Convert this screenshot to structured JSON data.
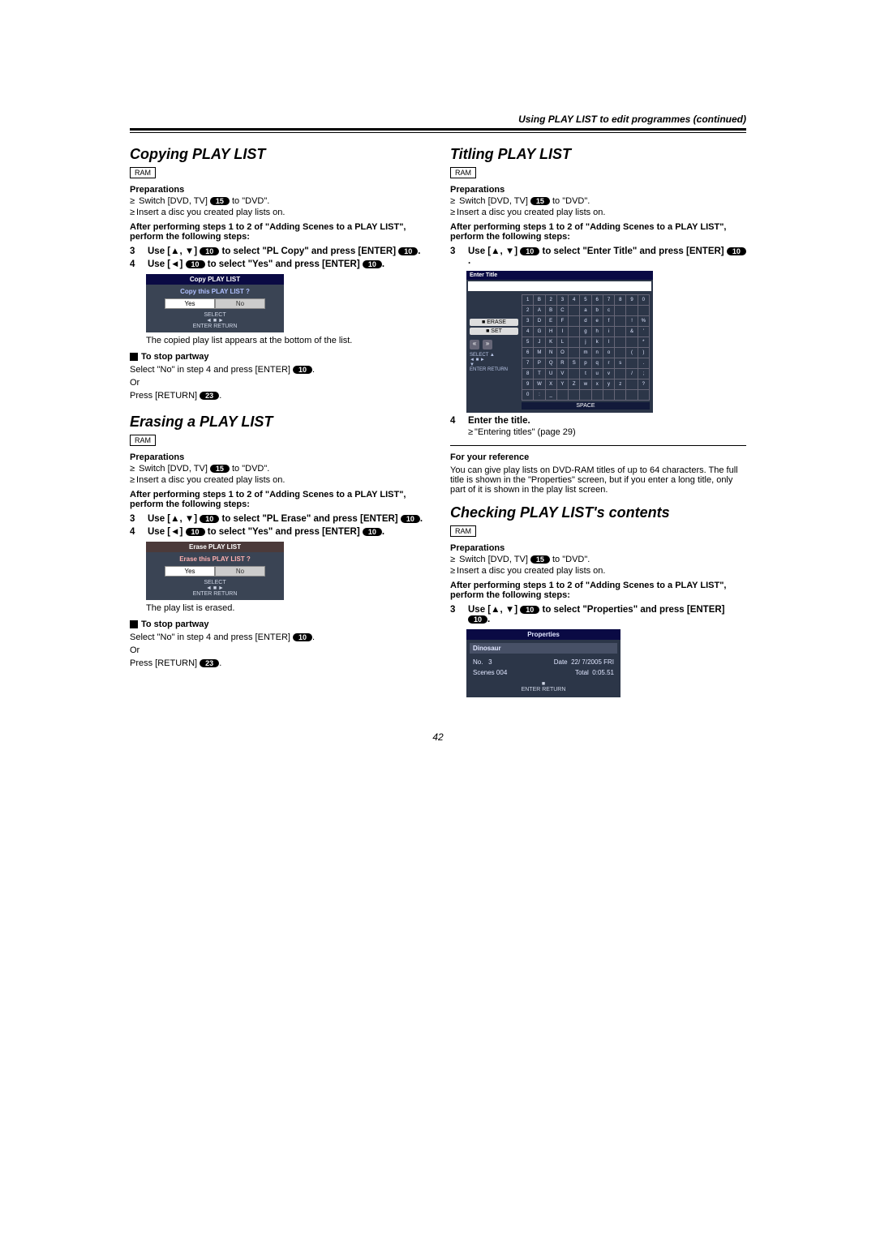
{
  "header": {
    "continued": "Using PLAY LIST to edit programmes (continued)"
  },
  "ram_label": "RAM",
  "prep_label": "Preparations",
  "prep_switch": "Switch [DVD, TV] ",
  "prep_switch_tail": " to \"DVD\".",
  "prep_insert": "Insert a disc you created play lists on.",
  "after_steps": "After performing steps 1 to 2 of \"Adding Scenes to a PLAY LIST\", perform the following steps:",
  "key10": "10",
  "key15": "15",
  "key23": "23",
  "copying": {
    "title": "Copying PLAY LIST",
    "step3a": "Use [",
    "step3arrows": "▲, ▼",
    "step3b": "] ",
    "step3c": " to select \"PL Copy\" and press [ENTER] ",
    "step4a": "Use [",
    "step4arrow": "◄",
    "step4b": "] ",
    "step4c": " to select \"Yes\" and press [ENTER] ",
    "dialog_title": "Copy PLAY LIST",
    "dialog_question": "Copy this PLAY LIST ?",
    "yes": "Yes",
    "no": "No",
    "dlg_foot1": "SELECT",
    "dlg_foot2": "ENTER       RETURN",
    "result": "The copied play list appears at the bottom of the list.",
    "stop_head": "To stop partway",
    "stop_line1a": "Select \"No\" in step 4 and press [ENTER] ",
    "stop_or": "Or",
    "stop_line2a": "Press [RETURN] ",
    "stop_line2b": "."
  },
  "erasing": {
    "title": "Erasing a PLAY LIST",
    "step3c": " to select \"PL Erase\" and press [ENTER] ",
    "dialog_title": "Erase PLAY LIST",
    "dialog_question": "Erase this PLAY LIST ?",
    "result": "The play list is erased."
  },
  "titling": {
    "title": "Titling PLAY LIST",
    "step3c": " to select \"Enter Title\" and press [ENTER] ",
    "panel_title": "Enter Title",
    "btn_erase": "ERASE",
    "btn_set": "SET",
    "pad_select": "SELECT",
    "pad_enter_return": "ENTER          RETURN",
    "space": "SPACE",
    "grid": [
      [
        "1",
        "B",
        "2",
        "3",
        "4",
        "5",
        "6",
        "7",
        "8",
        "9",
        "0"
      ],
      [
        "2",
        "A",
        "B",
        "C",
        "",
        "a",
        "b",
        "c",
        "",
        "",
        ""
      ],
      [
        "3",
        "D",
        "E",
        "F",
        "",
        "d",
        "e",
        "f",
        "",
        "!",
        "%"
      ],
      [
        "4",
        "G",
        "H",
        "I",
        "",
        "g",
        "h",
        "i",
        "",
        "&",
        "'"
      ],
      [
        "5",
        "J",
        "K",
        "L",
        "",
        "j",
        "k",
        "l",
        "",
        "",
        "*"
      ],
      [
        "6",
        "M",
        "N",
        "O",
        "",
        "m",
        "n",
        "o",
        "",
        "(",
        ")"
      ],
      [
        "7",
        "P",
        "Q",
        "R",
        "S",
        "p",
        "q",
        "r",
        "s",
        "",
        "."
      ],
      [
        "8",
        "T",
        "U",
        "V",
        "",
        "t",
        "u",
        "v",
        "",
        "/",
        ";"
      ],
      [
        "9",
        "W",
        "X",
        "Y",
        "Z",
        "w",
        "x",
        "y",
        "z",
        "",
        "?"
      ],
      [
        "0",
        ":",
        "_",
        "",
        "",
        "",
        "",
        "",
        "",
        "",
        ""
      ]
    ],
    "step4": "Enter the title.",
    "step4note": "\"Entering titles\" (page 29)",
    "ref_head": "For your reference",
    "ref_body": "You can give play lists on DVD-RAM titles of up to 64 characters. The full title is shown in the \"Properties\" screen, but if you enter a long title, only part of it is shown in the play list screen."
  },
  "checking": {
    "title": "Checking PLAY LIST's contents",
    "step3c": " to select \"Properties\" and press [ENTER] ",
    "panel_title": "Properties",
    "name": "Dinosaur",
    "no_lbl": "No.",
    "no_val": "3",
    "date_lbl": "Date",
    "date_val": "22/ 7/2005 FRI",
    "scenes_lbl": "Scenes",
    "scenes_val": "004",
    "total_lbl": "Total",
    "total_val": "0:05.51",
    "foot": "ENTER       RETURN"
  },
  "page_number": "42"
}
